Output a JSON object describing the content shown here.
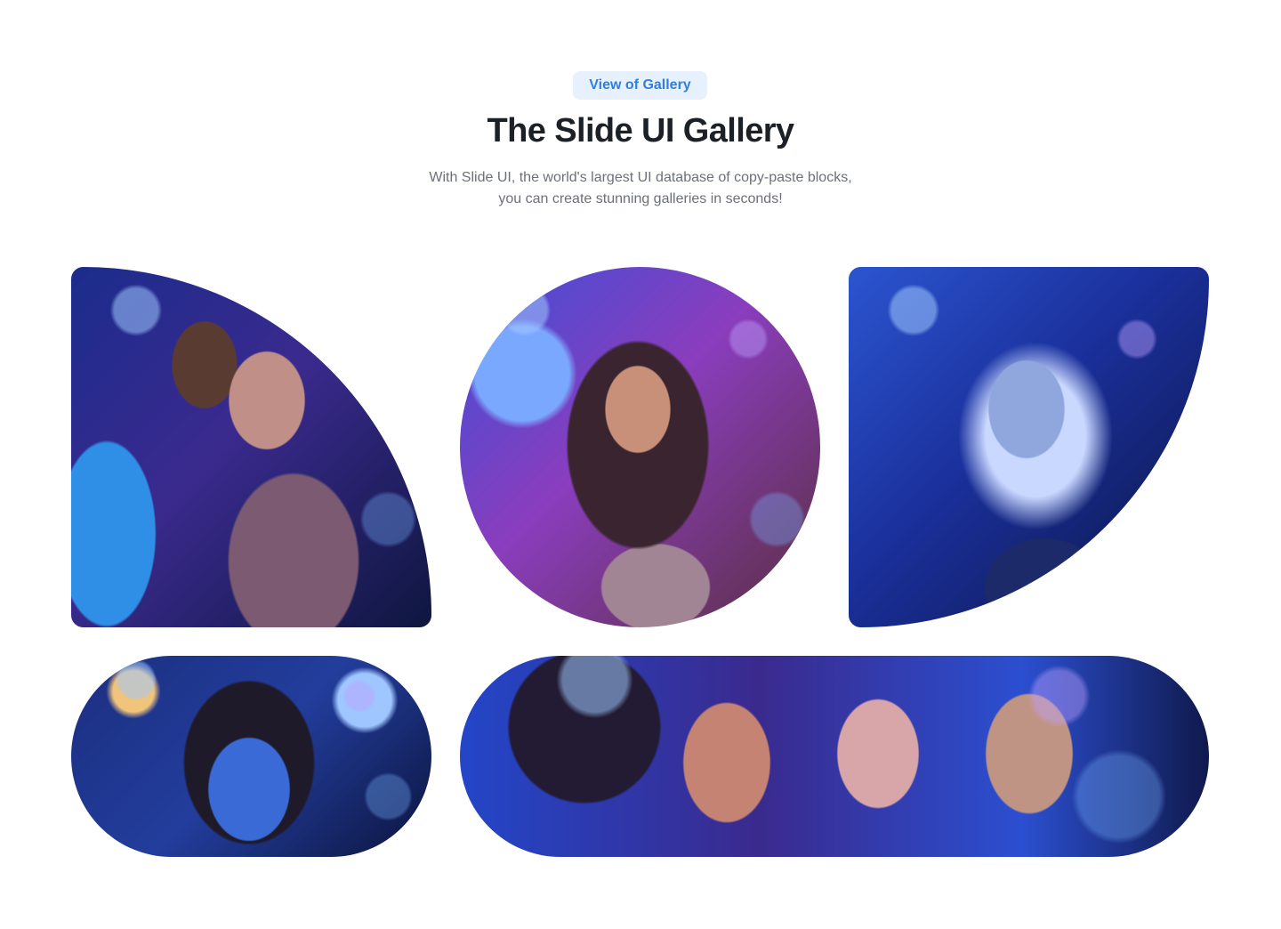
{
  "header": {
    "badge": "View of Gallery",
    "title": "The Slide UI Gallery",
    "subtitle_line1": "With Slide UI, the world's largest UI database of copy-paste blocks,",
    "subtitle_line2": "you can create stunning galleries in seconds!"
  },
  "gallery": {
    "items": [
      {
        "shape": "quarter-circle top-right",
        "subject": "three friends laughing at a party"
      },
      {
        "shape": "circle",
        "subject": "woman with neon face paint smiling"
      },
      {
        "shape": "quarter-circle bottom-right",
        "subject": "woman with glowing blue face paint"
      },
      {
        "shape": "pill",
        "subject": "woman with blue face paint"
      },
      {
        "shape": "wide pill",
        "subject": "three friends laughing together"
      }
    ]
  },
  "colors": {
    "accent": "#2f7fe0",
    "badge_bg": "#e6f1fd",
    "title": "#1c2128",
    "subtitle": "#6b7079",
    "background": "#ffffff"
  }
}
